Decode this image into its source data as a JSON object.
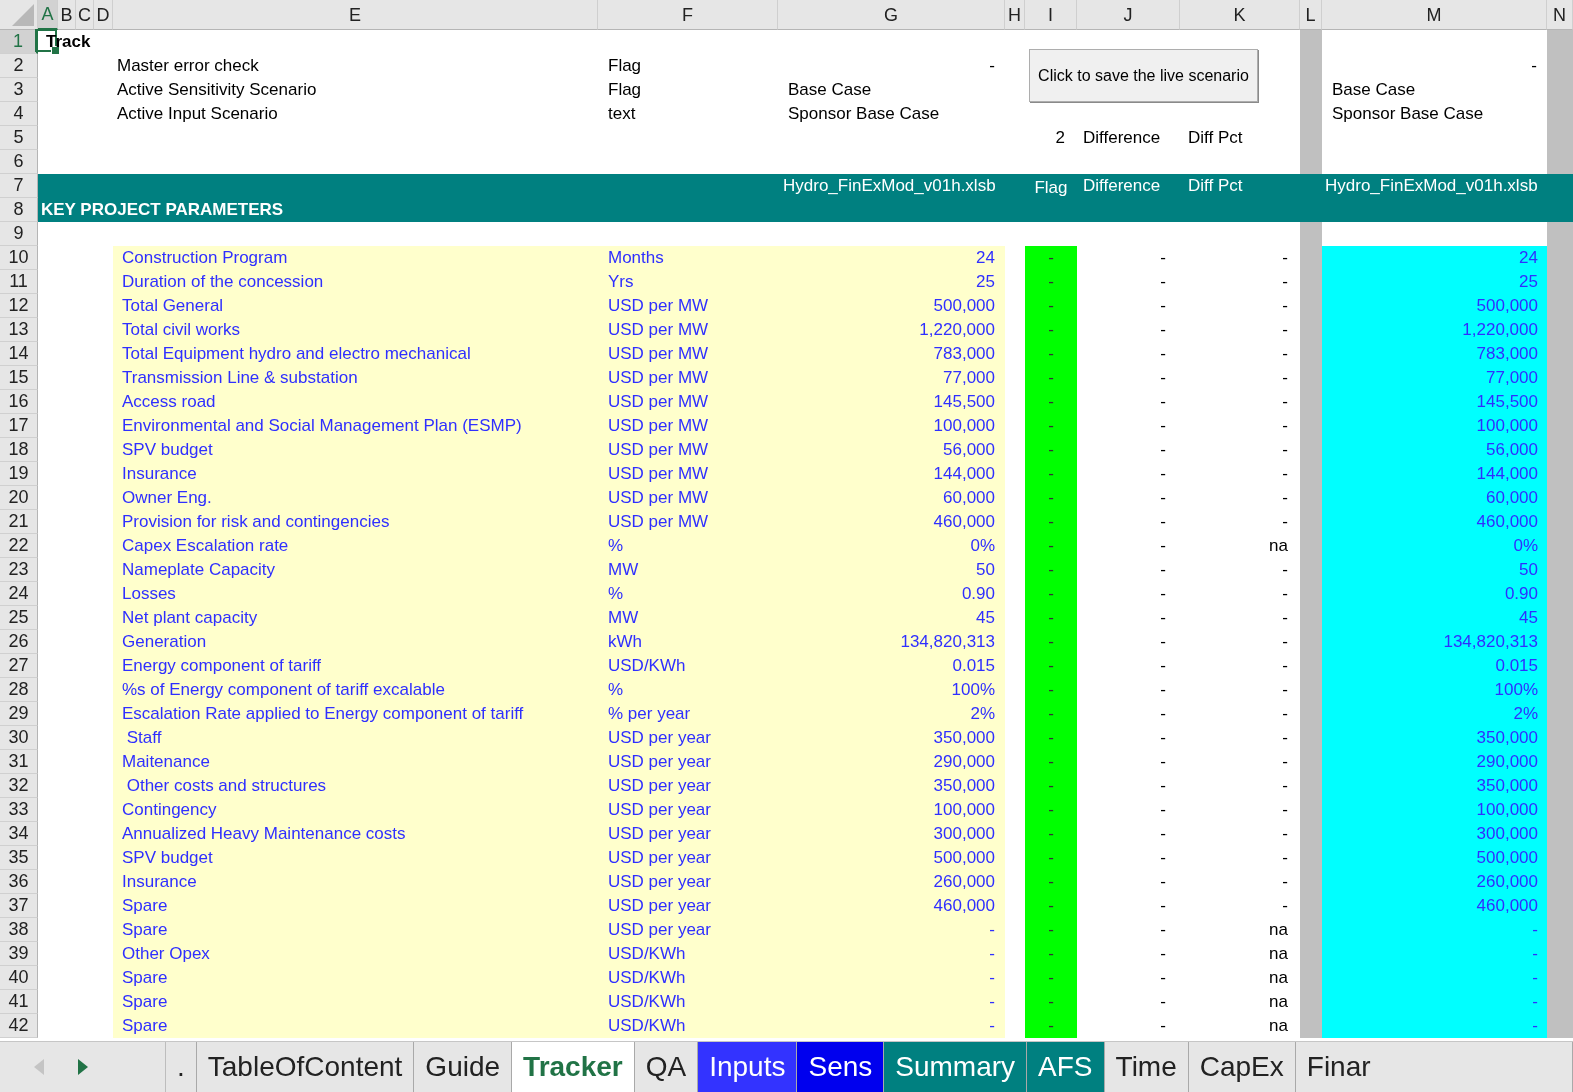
{
  "column_headers": [
    {
      "label": "A",
      "selected": true
    },
    {
      "label": "B",
      "selected": false
    },
    {
      "label": "C",
      "selected": false
    },
    {
      "label": "D",
      "selected": false
    },
    {
      "label": "E",
      "selected": false
    },
    {
      "label": "F",
      "selected": false
    },
    {
      "label": "G",
      "selected": false
    },
    {
      "label": "H",
      "selected": false
    },
    {
      "label": "I",
      "selected": false
    },
    {
      "label": "J",
      "selected": false
    },
    {
      "label": "K",
      "selected": false
    },
    {
      "label": "L",
      "selected": false
    },
    {
      "label": "M",
      "selected": false
    },
    {
      "label": "N",
      "selected": false
    }
  ],
  "save_button": "Click to save the live scenario",
  "rows": [
    {
      "number": "1",
      "selected": true,
      "kind": "title",
      "text": "Track"
    },
    {
      "number": "2",
      "selected": false,
      "kind": "info",
      "label": "Master error check",
      "unit": "Flag",
      "value": "-",
      "compare": "-"
    },
    {
      "number": "3",
      "selected": false,
      "kind": "info",
      "label": "Active Sensitivity Scenario",
      "unit": "Flag",
      "value": "Base Case",
      "compare": "Base Case"
    },
    {
      "number": "4",
      "selected": false,
      "kind": "info",
      "label": "Active Input Scenario",
      "unit": "text",
      "value": "Sponsor Base Case",
      "compare": "Sponsor Base Case"
    },
    {
      "number": "5",
      "selected": false,
      "kind": "diff_head",
      "count": "2",
      "difference": "Difference",
      "diff_pct": "Diff Pct"
    },
    {
      "number": "6",
      "selected": false,
      "kind": "blank"
    },
    {
      "number": "7",
      "selected": false,
      "kind": "band_top",
      "file": "Hydro_FinExMod_v01h.xlsb",
      "flag": "Flag",
      "difference": "Difference",
      "diff_pct": "Diff Pct",
      "compare": "Hydro_FinExMod_v01h.xlsb"
    },
    {
      "number": "8",
      "selected": false,
      "kind": "band_title",
      "text": "KEY PROJECT PARAMETERS"
    },
    {
      "number": "9",
      "selected": false,
      "kind": "blank"
    },
    {
      "number": "10",
      "selected": false,
      "kind": "param",
      "label": "Construction Program",
      "unit": "Months",
      "value": "24",
      "flag": "-",
      "difference": "-",
      "diff_pct": "-",
      "compare": "24"
    },
    {
      "number": "11",
      "selected": false,
      "kind": "param",
      "label": "Duration of the concession",
      "unit": "Yrs",
      "value": "25",
      "flag": "-",
      "difference": "-",
      "diff_pct": "-",
      "compare": "25"
    },
    {
      "number": "12",
      "selected": false,
      "kind": "param",
      "label": "Total General",
      "unit": "USD per MW",
      "value": "500,000",
      "flag": "-",
      "difference": "-",
      "diff_pct": "-",
      "compare": "500,000"
    },
    {
      "number": "13",
      "selected": false,
      "kind": "param",
      "label": "Total civil works",
      "unit": "USD per MW",
      "value": "1,220,000",
      "flag": "-",
      "difference": "-",
      "diff_pct": "-",
      "compare": "1,220,000"
    },
    {
      "number": "14",
      "selected": false,
      "kind": "param",
      "label": "Total Equipment hydro and electro mechanical",
      "unit": "USD per MW",
      "value": "783,000",
      "flag": "-",
      "difference": "-",
      "diff_pct": "-",
      "compare": "783,000"
    },
    {
      "number": "15",
      "selected": false,
      "kind": "param",
      "label": "Transmission Line & substation",
      "unit": "USD per MW",
      "value": "77,000",
      "flag": "-",
      "difference": "-",
      "diff_pct": "-",
      "compare": "77,000"
    },
    {
      "number": "16",
      "selected": false,
      "kind": "param",
      "label": "Access road",
      "unit": "USD per MW",
      "value": "145,500",
      "flag": "-",
      "difference": "-",
      "diff_pct": "-",
      "compare": "145,500"
    },
    {
      "number": "17",
      "selected": false,
      "kind": "param",
      "label": "Environmental and Social Management Plan (ESMP)",
      "unit": "USD per MW",
      "value": "100,000",
      "flag": "-",
      "difference": "-",
      "diff_pct": "-",
      "compare": "100,000"
    },
    {
      "number": "18",
      "selected": false,
      "kind": "param",
      "label": "SPV budget",
      "unit": "USD per MW",
      "value": "56,000",
      "flag": "-",
      "difference": "-",
      "diff_pct": "-",
      "compare": "56,000"
    },
    {
      "number": "19",
      "selected": false,
      "kind": "param",
      "label": "Insurance",
      "unit": "USD per MW",
      "value": "144,000",
      "flag": "-",
      "difference": "-",
      "diff_pct": "-",
      "compare": "144,000"
    },
    {
      "number": "20",
      "selected": false,
      "kind": "param",
      "label": "Owner Eng.",
      "unit": "USD per MW",
      "value": "60,000",
      "flag": "-",
      "difference": "-",
      "diff_pct": "-",
      "compare": "60,000"
    },
    {
      "number": "21",
      "selected": false,
      "kind": "param",
      "label": "Provision for risk and contingencies",
      "unit": "USD per MW",
      "value": "460,000",
      "flag": "-",
      "difference": "-",
      "diff_pct": "-",
      "compare": "460,000"
    },
    {
      "number": "22",
      "selected": false,
      "kind": "param",
      "label": "Capex Escalation rate",
      "unit": "%",
      "value": "0%",
      "flag": "-",
      "difference": "-",
      "diff_pct": "na",
      "compare": "0%"
    },
    {
      "number": "23",
      "selected": false,
      "kind": "param",
      "label": "Nameplate Capacity",
      "unit": "MW",
      "value": "50",
      "flag": "-",
      "difference": "-",
      "diff_pct": "-",
      "compare": "50"
    },
    {
      "number": "24",
      "selected": false,
      "kind": "param",
      "label": "Losses",
      "unit": "%",
      "value": "0.90",
      "flag": "-",
      "difference": "-",
      "diff_pct": "-",
      "compare": "0.90"
    },
    {
      "number": "25",
      "selected": false,
      "kind": "param",
      "label": "Net plant capacity",
      "unit": "MW",
      "value": "45",
      "flag": "-",
      "difference": "-",
      "diff_pct": "-",
      "compare": "45"
    },
    {
      "number": "26",
      "selected": false,
      "kind": "param",
      "label": "Generation",
      "unit": "kWh",
      "value": "134,820,313",
      "flag": "-",
      "difference": "-",
      "diff_pct": "-",
      "compare": "134,820,313"
    },
    {
      "number": "27",
      "selected": false,
      "kind": "param",
      "label": "Energy component of tariff",
      "unit": "USD/KWh",
      "value": "0.015",
      "flag": "-",
      "difference": "-",
      "diff_pct": "-",
      "compare": "0.015"
    },
    {
      "number": "28",
      "selected": false,
      "kind": "param",
      "label": "%s of Energy component of tariff excalable",
      "unit": "%",
      "value": "100%",
      "flag": "-",
      "difference": "-",
      "diff_pct": "-",
      "compare": "100%"
    },
    {
      "number": "29",
      "selected": false,
      "kind": "param",
      "label": "Escalation Rate applied to Energy component of tariff",
      "unit": "% per year",
      "value": "2%",
      "flag": "-",
      "difference": "-",
      "diff_pct": "-",
      "compare": "2%"
    },
    {
      "number": "30",
      "selected": false,
      "kind": "param",
      "label": " Staff",
      "unit": "USD per year",
      "value": "350,000",
      "flag": "-",
      "difference": "-",
      "diff_pct": "-",
      "compare": "350,000"
    },
    {
      "number": "31",
      "selected": false,
      "kind": "param",
      "label": "Maitenance",
      "unit": "USD per year",
      "value": "290,000",
      "flag": "-",
      "difference": "-",
      "diff_pct": "-",
      "compare": "290,000"
    },
    {
      "number": "32",
      "selected": false,
      "kind": "param",
      "label": " Other costs and structures",
      "unit": "USD per year",
      "value": "350,000",
      "flag": "-",
      "difference": "-",
      "diff_pct": "-",
      "compare": "350,000"
    },
    {
      "number": "33",
      "selected": false,
      "kind": "param",
      "label": "Contingency",
      "unit": "USD per year",
      "value": "100,000",
      "flag": "-",
      "difference": "-",
      "diff_pct": "-",
      "compare": "100,000"
    },
    {
      "number": "34",
      "selected": false,
      "kind": "param",
      "label": "Annualized Heavy Maintenance costs",
      "unit": "USD per year",
      "value": "300,000",
      "flag": "-",
      "difference": "-",
      "diff_pct": "-",
      "compare": "300,000"
    },
    {
      "number": "35",
      "selected": false,
      "kind": "param",
      "label": "SPV budget",
      "unit": "USD per year",
      "value": "500,000",
      "flag": "-",
      "difference": "-",
      "diff_pct": "-",
      "compare": "500,000"
    },
    {
      "number": "36",
      "selected": false,
      "kind": "param",
      "label": "Insurance",
      "unit": "USD per year",
      "value": "260,000",
      "flag": "-",
      "difference": "-",
      "diff_pct": "-",
      "compare": "260,000"
    },
    {
      "number": "37",
      "selected": false,
      "kind": "param",
      "label": "Spare",
      "unit": "USD per year",
      "value": "460,000",
      "flag": "-",
      "difference": "-",
      "diff_pct": "-",
      "compare": "460,000"
    },
    {
      "number": "38",
      "selected": false,
      "kind": "param",
      "label": "Spare",
      "unit": "USD per year",
      "value": "-",
      "flag": "-",
      "difference": "-",
      "diff_pct": "na",
      "compare": "-"
    },
    {
      "number": "39",
      "selected": false,
      "kind": "param",
      "label": "Other Opex",
      "unit": "USD/KWh",
      "value": "-",
      "flag": "-",
      "difference": "-",
      "diff_pct": "na",
      "compare": "-"
    },
    {
      "number": "40",
      "selected": false,
      "kind": "param",
      "label": "Spare",
      "unit": "USD/KWh",
      "value": "-",
      "flag": "-",
      "difference": "-",
      "diff_pct": "na",
      "compare": "-"
    },
    {
      "number": "41",
      "selected": false,
      "kind": "param",
      "label": "Spare",
      "unit": "USD/KWh",
      "value": "-",
      "flag": "-",
      "difference": "-",
      "diff_pct": "na",
      "compare": "-"
    },
    {
      "number": "42",
      "selected": false,
      "kind": "param",
      "label": "Spare",
      "unit": "USD/KWh",
      "value": "-",
      "flag": "-",
      "difference": "-",
      "diff_pct": "na",
      "compare": "-"
    }
  ],
  "sheet_tabs": [
    {
      "label": ".",
      "selected": false
    },
    {
      "label": "TableOfContent",
      "selected": false
    },
    {
      "label": "Guide",
      "selected": false
    },
    {
      "label": "Tracker",
      "selected": true
    },
    {
      "label": "QA",
      "selected": false
    },
    {
      "label": "Inputs",
      "selected": false,
      "color": "#3333ff"
    },
    {
      "label": "Sens",
      "selected": false,
      "color": "#0000ee"
    },
    {
      "label": "Summary",
      "selected": false,
      "color": "#008080"
    },
    {
      "label": "AFS",
      "selected": false,
      "color": "#008080"
    },
    {
      "label": "Time",
      "selected": false
    },
    {
      "label": "CapEx",
      "selected": false
    },
    {
      "label": "Finar",
      "selected": false
    }
  ]
}
